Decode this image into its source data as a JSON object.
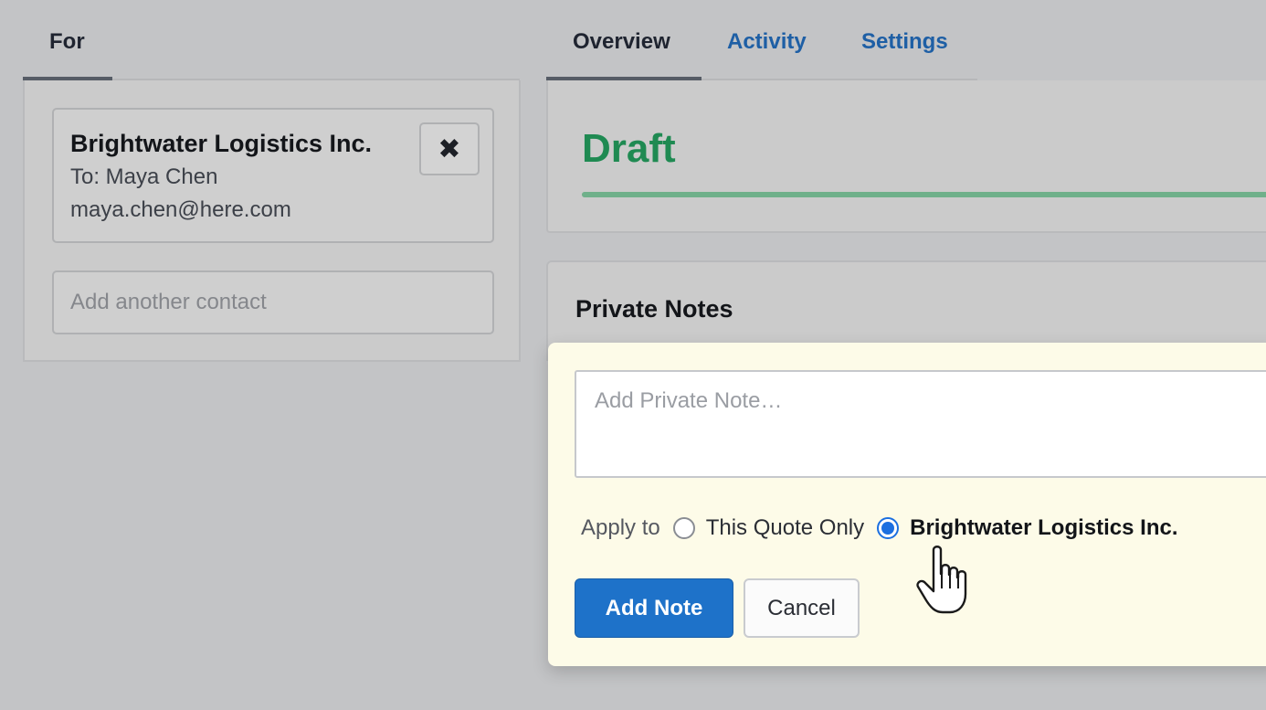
{
  "left": {
    "tab_label": "For",
    "contact": {
      "company": "Brightwater Logistics Inc.",
      "to_line": "To: Maya Chen",
      "email": "maya.chen@here.com",
      "remove_symbol": "✖"
    },
    "add_contact_placeholder": "Add another contact"
  },
  "tabs": {
    "overview": "Overview",
    "activity": "Activity",
    "settings": "Settings",
    "active": "overview"
  },
  "status": {
    "label": "Draft",
    "progress": 1.0,
    "color": "#1f8a52"
  },
  "notes": {
    "title": "Private Notes",
    "textarea_placeholder": "Add Private Note…",
    "apply_to_label": "Apply to",
    "options": [
      {
        "label": "This Quote Only",
        "checked": false
      },
      {
        "label": "Brightwater Logistics Inc.",
        "checked": true
      }
    ],
    "add_button": "Add Note",
    "cancel_button": "Cancel"
  },
  "colors": {
    "link_blue": "#1e5fa5",
    "primary_button": "#1e72c9",
    "radio_accent": "#1b6fe0",
    "popup_bg": "#fdfbe8"
  },
  "icons": {
    "remove_contact": "close-icon",
    "pointer": "hand-pointer-icon"
  }
}
